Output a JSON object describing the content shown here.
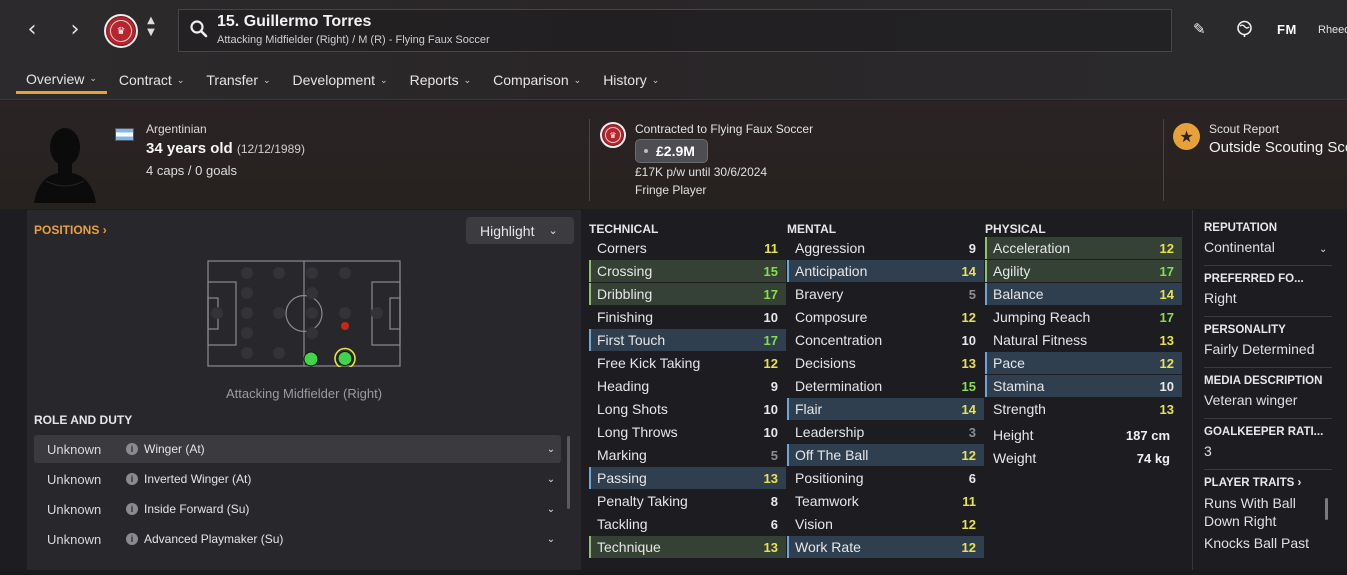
{
  "header": {
    "player_title": "15. Guillermo Torres",
    "player_subtitle": "Attacking Midfielder (Right) / M (R) - Flying Faux Soccer",
    "fm_logo": "FM",
    "user_name": "Rheede"
  },
  "tabs": [
    {
      "label": "Overview"
    },
    {
      "label": "Contract"
    },
    {
      "label": "Transfer"
    },
    {
      "label": "Development"
    },
    {
      "label": "Reports"
    },
    {
      "label": "Comparison"
    },
    {
      "label": "History"
    }
  ],
  "profile": {
    "nationality": "Argentinian",
    "age": "34 years old",
    "dob": "(12/12/1989)",
    "caps": "4 caps / 0 goals"
  },
  "contract": {
    "title": "Contracted to Flying Faux Soccer",
    "value": "£2.9M",
    "wage": "£17K p/w until 30/6/2024",
    "status": "Fringe Player"
  },
  "scout": {
    "label": "Scout Report",
    "value": "Outside Scouting Scope"
  },
  "positions": {
    "heading": "POSITIONS",
    "highlight_label": "Highlight",
    "caption": "Attacking Midfielder (Right)"
  },
  "roles": {
    "heading": "ROLE AND DUTY",
    "items": [
      {
        "ability": "Unknown",
        "role": "Winger (At)"
      },
      {
        "ability": "Unknown",
        "role": "Inverted Winger (At)"
      },
      {
        "ability": "Unknown",
        "role": "Inside Forward (Su)"
      },
      {
        "ability": "Unknown",
        "role": "Advanced Playmaker (Su)"
      }
    ]
  },
  "attributes": {
    "technical_heading": "TECHNICAL",
    "mental_heading": "MENTAL",
    "physical_heading": "PHYSICAL",
    "technical": [
      {
        "name": "Corners",
        "value": 11
      },
      {
        "name": "Crossing",
        "value": 15
      },
      {
        "name": "Dribbling",
        "value": 17
      },
      {
        "name": "Finishing",
        "value": 10
      },
      {
        "name": "First Touch",
        "value": 17
      },
      {
        "name": "Free Kick Taking",
        "value": 12
      },
      {
        "name": "Heading",
        "value": 9
      },
      {
        "name": "Long Shots",
        "value": 10
      },
      {
        "name": "Long Throws",
        "value": 10
      },
      {
        "name": "Marking",
        "value": 5
      },
      {
        "name": "Passing",
        "value": 13
      },
      {
        "name": "Penalty Taking",
        "value": 8
      },
      {
        "name": "Tackling",
        "value": 6
      },
      {
        "name": "Technique",
        "value": 13
      }
    ],
    "mental": [
      {
        "name": "Aggression",
        "value": 9
      },
      {
        "name": "Anticipation",
        "value": 14
      },
      {
        "name": "Bravery",
        "value": 5
      },
      {
        "name": "Composure",
        "value": 12
      },
      {
        "name": "Concentration",
        "value": 10
      },
      {
        "name": "Decisions",
        "value": 13
      },
      {
        "name": "Determination",
        "value": 15
      },
      {
        "name": "Flair",
        "value": 14
      },
      {
        "name": "Leadership",
        "value": 3
      },
      {
        "name": "Off The Ball",
        "value": 12
      },
      {
        "name": "Positioning",
        "value": 6
      },
      {
        "name": "Teamwork",
        "value": 11
      },
      {
        "name": "Vision",
        "value": 12
      },
      {
        "name": "Work Rate",
        "value": 12
      }
    ],
    "physical": [
      {
        "name": "Acceleration",
        "value": 12
      },
      {
        "name": "Agility",
        "value": 17
      },
      {
        "name": "Balance",
        "value": 14
      },
      {
        "name": "Jumping Reach",
        "value": 17
      },
      {
        "name": "Natural Fitness",
        "value": 13
      },
      {
        "name": "Pace",
        "value": 12
      },
      {
        "name": "Stamina",
        "value": 10
      },
      {
        "name": "Strength",
        "value": 13
      }
    ],
    "height_label": "Height",
    "height_value": "187 cm",
    "weight_label": "Weight",
    "weight_value": "74 kg"
  },
  "info": {
    "reputation_label": "REPUTATION",
    "reputation_value": "Continental",
    "preferred_foot_label": "PREFERRED FO...",
    "preferred_foot_value": "Right",
    "personality_label": "PERSONALITY",
    "personality_value": "Fairly Determined",
    "media_label": "MEDIA DESCRIPTION",
    "media_value": "Veteran winger",
    "gk_label": "GOALKEEPER RATI...",
    "gk_value": "3",
    "traits_label": "PLAYER TRAITS",
    "trait_1": "Runs With Ball Down Right",
    "trait_2": "Knocks Ball Past"
  },
  "colors": {
    "accent": "#e8a13a",
    "club_red": "#b5252d",
    "green_highlight": "#344134",
    "blue_highlight": "#2f3f4f",
    "value_green": "#84df4a",
    "value_yellow": "#e7e34c"
  }
}
